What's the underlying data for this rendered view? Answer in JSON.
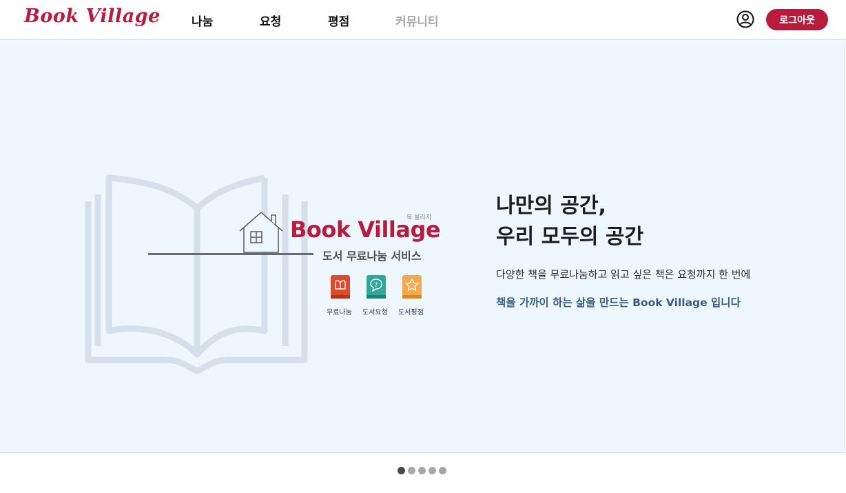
{
  "header": {
    "logo": "Book Village",
    "nav": [
      {
        "label": "나눔"
      },
      {
        "label": "요청"
      },
      {
        "label": "평점"
      },
      {
        "label": "커뮤니티"
      }
    ],
    "logout_label": "로그아웃"
  },
  "hero": {
    "illustration": {
      "brand_small": "북 빌리지",
      "brand_big": "Book Village",
      "brand_sub": "도서 무료나눔 서비스",
      "services": [
        {
          "label": "무료나눔",
          "color": "#e04a2c",
          "icon": "gift-book-icon"
        },
        {
          "label": "도서요청",
          "color": "#2fa79b",
          "icon": "question-book-icon"
        },
        {
          "label": "도서평점",
          "color": "#f5a94a",
          "icon": "star-book-icon"
        }
      ]
    },
    "title_line1": "나만의 공간,",
    "title_line2": "우리 모두의 공간",
    "desc": "다양한 책을 무료나눔하고 읽고 싶은 책은 요청까지 한 번에",
    "tagline": "책을 가까이 하는 삶을 만드는 Book Village 입니다"
  },
  "carousel": {
    "total": 5,
    "active": 1
  },
  "colors": {
    "brand": "#b71c3c",
    "hero_bg": "#eef6fe",
    "tagline": "#375e80"
  }
}
